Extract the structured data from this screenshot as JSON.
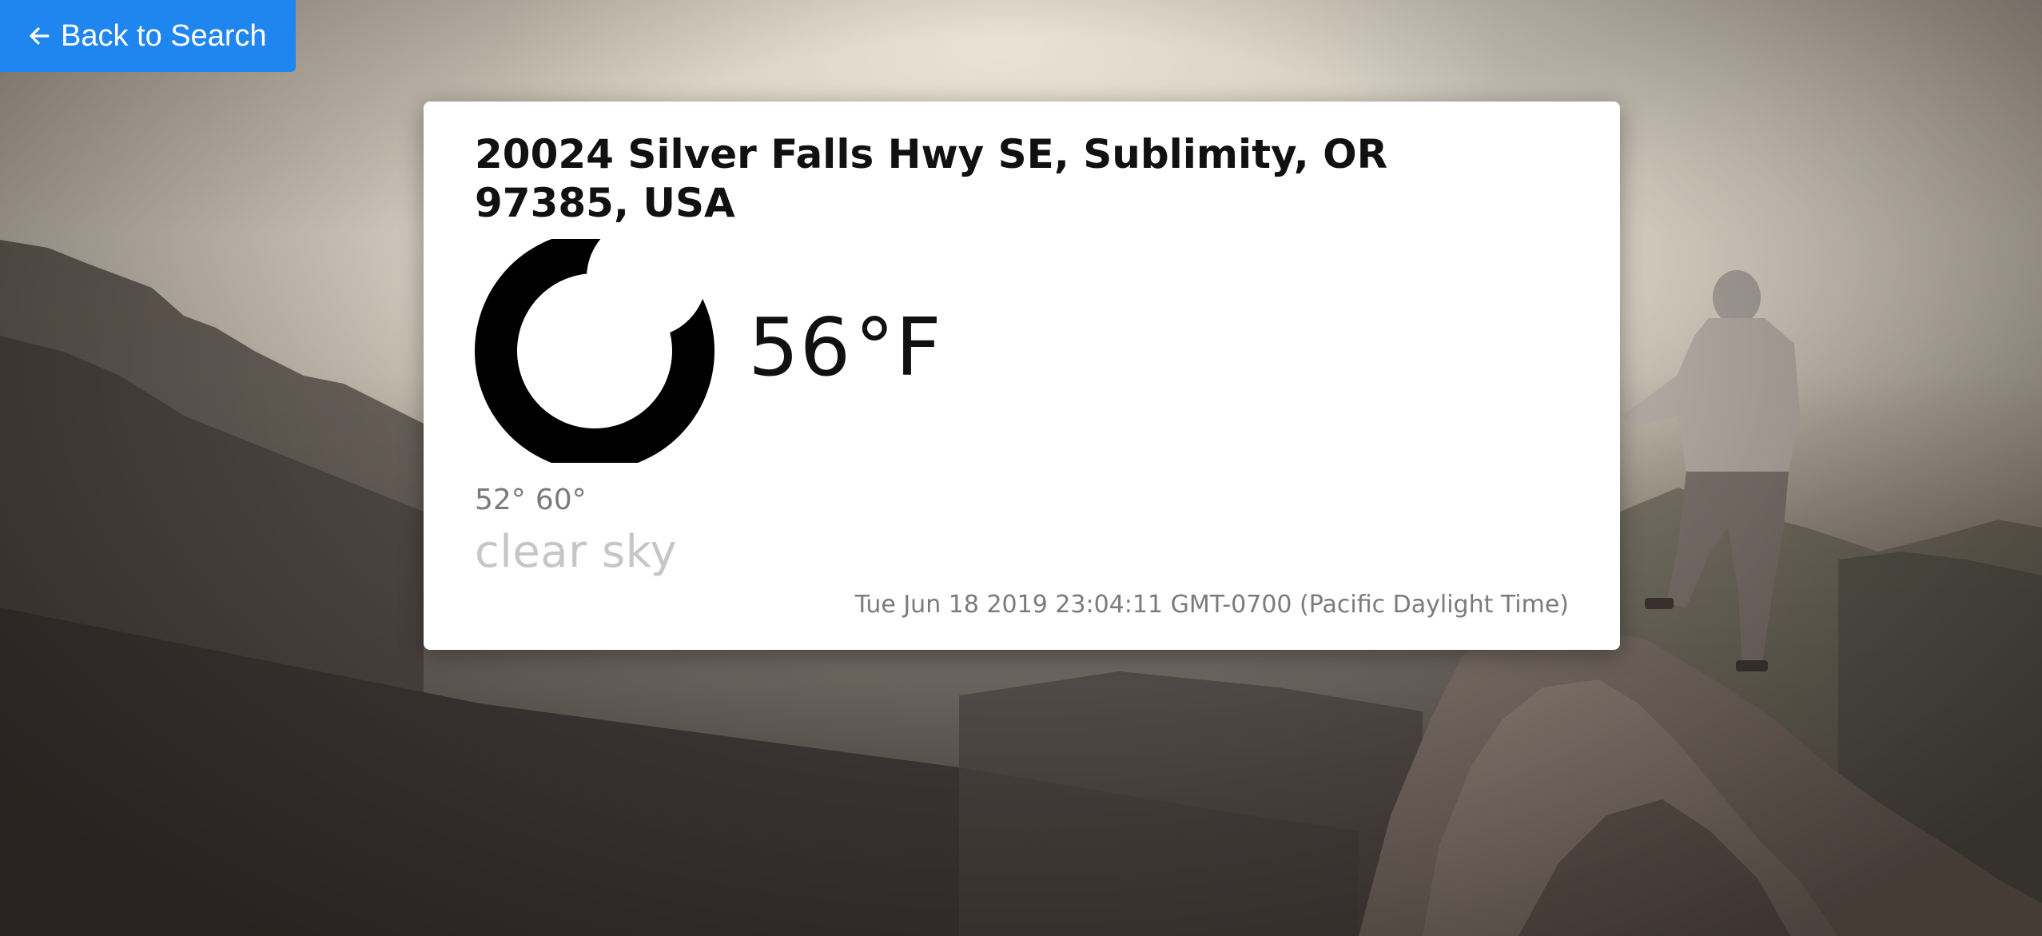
{
  "back_button": {
    "label": "Back to Search",
    "icon": "arrow-left-icon",
    "color": "#1f86f0"
  },
  "location": {
    "address": "20024 Silver Falls Hwy SE, Sublimity, OR 97385, USA"
  },
  "current": {
    "icon": "moon-clear-night-icon",
    "temperature": "56",
    "unit": "°F",
    "temp_min": "52°",
    "temp_max": "60°",
    "description": "clear sky",
    "timestamp": "Tue Jun 18 2019 23:04:11 GMT-0700 (Pacific Daylight Time)"
  },
  "background": {
    "subject": "hiker standing on rocky mountain peak"
  }
}
